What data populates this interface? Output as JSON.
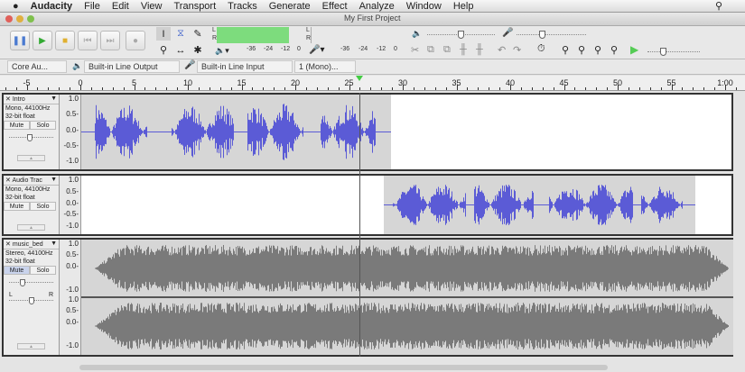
{
  "menu": {
    "apple": "",
    "app": "Audacity",
    "items": [
      "File",
      "Edit",
      "View",
      "Transport",
      "Tracks",
      "Generate",
      "Effect",
      "Analyze",
      "Window",
      "Help"
    ]
  },
  "window": {
    "title": "My First Project"
  },
  "meters": {
    "play_ticks": [
      "-36",
      "-24",
      "-12",
      "0"
    ],
    "rec_ticks": [
      "-36",
      "-24",
      "-12",
      "0"
    ],
    "L": "L",
    "R": "R"
  },
  "device": {
    "host": "Core Au...",
    "output": "Built-in Line Output",
    "input": "Built-in Line Input",
    "channels": "1 (Mono)..."
  },
  "ruler": {
    "labels": [
      "-5",
      "0",
      "5",
      "10",
      "15",
      "20",
      "25",
      "30",
      "35",
      "40",
      "45",
      "50",
      "55",
      "1:00"
    ],
    "values": [
      -5,
      0,
      5,
      10,
      15,
      20,
      25,
      30,
      35,
      40,
      45,
      50,
      55,
      60
    ]
  },
  "tracks": [
    {
      "name": "Intro",
      "format": "Mono, 44100Hz",
      "bits": "32-bit float",
      "mute": "Mute",
      "solo": "Solo",
      "scale": [
        "1.0",
        "0.5-",
        "0.0-",
        "-0.5-",
        "-1.0"
      ]
    },
    {
      "name": "Audio Trac",
      "format": "Mono, 44100Hz",
      "bits": "32-bit float",
      "mute": "Mute",
      "solo": "Solo",
      "scale": [
        "1.0",
        "0.5-",
        "0.0-",
        "-0.5-",
        "-1.0"
      ]
    },
    {
      "name": "music_bed",
      "format": "Stereo, 44100Hz",
      "bits": "32-bit float",
      "mute": "Mute",
      "solo": "Solo",
      "pan_l": "L",
      "pan_r": "R",
      "scale": [
        "1.0",
        "0.5-",
        "0.0-",
        "-1.0"
      ]
    }
  ],
  "colors": {
    "voice": "#5b5bd6",
    "music": "#7a7a7a",
    "meter": "#7ddc7d"
  }
}
